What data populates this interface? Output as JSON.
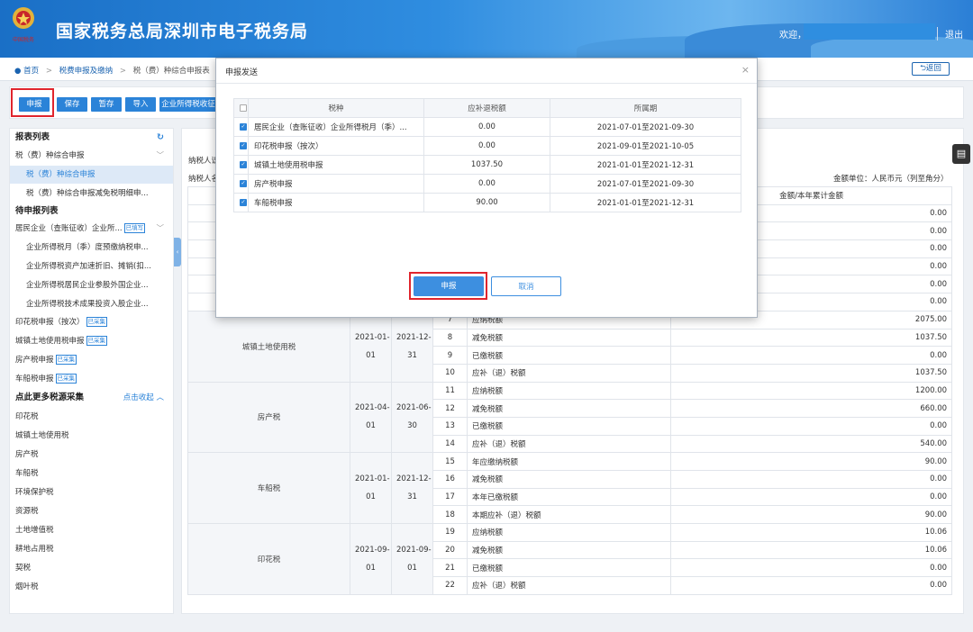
{
  "header": {
    "title": "国家税务总局深圳市电子税务局",
    "welcome": "欢迎，",
    "logout": "退出",
    "emblem_text": "中国税务"
  },
  "breadcrumb": {
    "home": "首页",
    "sep": ">",
    "level1": "税费申报及缴纳",
    "level2": "税（费）种综合申报表",
    "back": "返回"
  },
  "toolbar": {
    "declare": "申报",
    "save": "保存",
    "temp": "暂存",
    "import": "导入",
    "extra": "企业所得税收征管"
  },
  "sidebar": {
    "report_list": "报表列表",
    "group1": "税（费）种综合申报",
    "item1": "税（费）种综合申报",
    "item2": "税（费）种综合申报减免税明细申...",
    "pending": "待申报列表",
    "pending1": "居民企业（查账征收）企业所...",
    "pending1_tag": "已填写",
    "sub1": "企业所得税月（季）度预缴纳税申...",
    "sub2": "企业所得税资产加速折旧、摊销(扣...",
    "sub3": "企业所得税居民企业参股外国企业...",
    "sub4": "企业所得税技术成果投资入股企业...",
    "p2": "印花税申报（按次）",
    "p2_tag": "已采集",
    "p3": "城镇土地使用税申报",
    "p3_tag": "已采集",
    "p4": "房产税申报",
    "p4_tag": "已采集",
    "p5": "车船税申报",
    "p5_tag": "已采集",
    "more": "点此更多税源采集",
    "collapse_link": "点击收起",
    "taxes": [
      "印花税",
      "城镇土地使用税",
      "房产税",
      "车船税",
      "环境保护税",
      "资源税",
      "土地增值税",
      "耕地占用税",
      "契税",
      "烟叶税"
    ]
  },
  "main": {
    "taxpayer_id_label": "纳税人识",
    "taxpayer_name_label": "纳税人名",
    "unit": "金额单位：人民币元（列至角分）",
    "amount_header": "金额/本年累计金额",
    "top_amounts": [
      "0.00",
      "0.00",
      "0.00",
      "0.00",
      "0.00",
      "0.00"
    ],
    "row7": {
      "no": "7",
      "item": "应纳税额",
      "amt": "2075.00"
    },
    "groups": [
      {
        "name": "城镇土地使用税",
        "start": "2021-01-01",
        "end": "2021-12-31",
        "start_a": "2021-01-",
        "start_b": "01",
        "end_a": "2021-12-",
        "end_b": "31",
        "rows": [
          [
            "8",
            "减免税额",
            "1037.50"
          ],
          [
            "9",
            "已缴税额",
            "0.00"
          ],
          [
            "10",
            "应补（退）税额",
            "1037.50"
          ]
        ]
      },
      {
        "name": "房产税",
        "start_a": "2021-04-",
        "start_b": "01",
        "end_a": "2021-06-",
        "end_b": "30",
        "rows": [
          [
            "11",
            "应纳税额",
            "1200.00"
          ],
          [
            "12",
            "减免税额",
            "660.00"
          ],
          [
            "13",
            "已缴税额",
            "0.00"
          ],
          [
            "14",
            "应补（退）税额",
            "540.00"
          ]
        ]
      },
      {
        "name": "车船税",
        "start_a": "2021-01-",
        "start_b": "01",
        "end_a": "2021-12-",
        "end_b": "31",
        "rows": [
          [
            "15",
            "年应缴纳税额",
            "90.00"
          ],
          [
            "16",
            "减免税额",
            "0.00"
          ],
          [
            "17",
            "本年已缴税额",
            "0.00"
          ],
          [
            "18",
            "本期应补（退）税额",
            "90.00"
          ]
        ]
      },
      {
        "name": "印花税",
        "start_a": "2021-09-",
        "start_b": "01",
        "end_a": "2021-09-",
        "end_b": "01",
        "rows": [
          [
            "19",
            "应纳税额",
            "10.06"
          ],
          [
            "20",
            "减免税额",
            "10.06"
          ],
          [
            "21",
            "已缴税额",
            "0.00"
          ],
          [
            "22",
            "应补（退）税额",
            "0.00"
          ]
        ]
      }
    ]
  },
  "modal": {
    "title": "申报发送",
    "close": "×",
    "col_tax": "税种",
    "col_amount": "应补退税额",
    "col_period": "所属期",
    "rows": [
      {
        "tax": "居民企业（查账征收）企业所得税月（季）...",
        "amount": "0.00",
        "period": "2021-07-01至2021-09-30"
      },
      {
        "tax": "印花税申报（按次）",
        "amount": "0.00",
        "period": "2021-09-01至2021-10-05"
      },
      {
        "tax": "城镇土地使用税申报",
        "amount": "1037.50",
        "period": "2021-01-01至2021-12-31"
      },
      {
        "tax": "房产税申报",
        "amount": "0.00",
        "period": "2021-07-01至2021-09-30"
      },
      {
        "tax": "车船税申报",
        "amount": "90.00",
        "period": "2021-01-01至2021-12-31"
      }
    ],
    "ok": "申报",
    "cancel": "取消"
  }
}
